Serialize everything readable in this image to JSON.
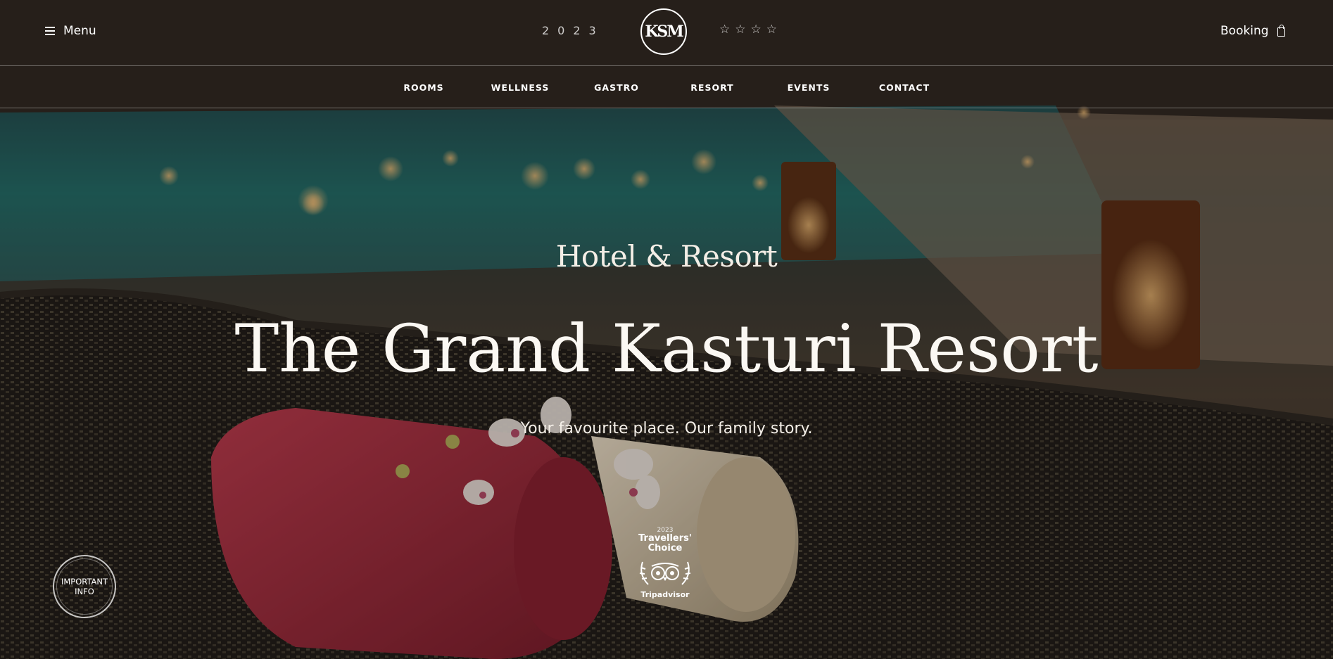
{
  "header": {
    "menu_label": "Menu",
    "year": "2023",
    "logo_text": "KSM",
    "stars": [
      "☆",
      "☆",
      "☆",
      "☆"
    ],
    "booking_label": "Booking"
  },
  "nav": {
    "items": [
      {
        "label": "ROOMS"
      },
      {
        "label": "WELLNESS"
      },
      {
        "label": "GASTRO"
      },
      {
        "label": "RESORT"
      },
      {
        "label": "EVENTS"
      },
      {
        "label": "CONTACT"
      }
    ]
  },
  "hero": {
    "subtitle": "Hotel & Resort",
    "title": "The Grand Kasturi Resort",
    "tagline": "Your favourite place. Our family story."
  },
  "badges": {
    "important_info": "IMPORTANT INFO",
    "tripadvisor_year": "2023",
    "tripadvisor_title": "Travellers' Choice",
    "tripadvisor_brand": "Tripadvisor"
  },
  "colors": {
    "text": "#ffffff",
    "overlay": "#1b1612",
    "pool": "#1f6e6a",
    "towel_red": "#b42a40",
    "towel_cream": "#d8c8aa"
  }
}
